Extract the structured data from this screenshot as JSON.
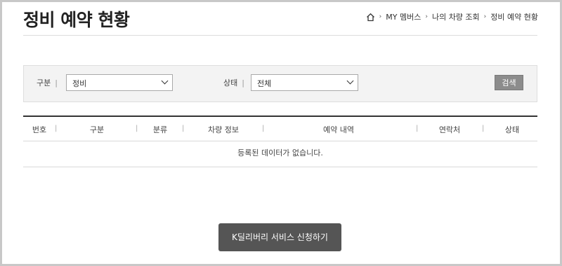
{
  "page": {
    "title": "정비 예약 현황"
  },
  "breadcrumb": {
    "home_icon": "home-icon",
    "items": [
      "MY 멤버스",
      "나의 차량 조회",
      "정비 예약 현황"
    ],
    "separator": "›"
  },
  "search": {
    "category_label": "구분",
    "category_value": "정비",
    "status_label": "상태",
    "status_value": "전체",
    "button_label": "검색"
  },
  "table": {
    "headers": [
      "번호",
      "구분",
      "분류",
      "차량 정보",
      "예약 내역",
      "연락처",
      "상태"
    ],
    "empty_message": "등록된 데이터가 없습니다."
  },
  "cta": {
    "label": "K딜리버리 서비스 신청하기"
  },
  "colors": {
    "cta_bg": "#555555",
    "search_button_bg": "#8c8c8c",
    "table_top_rule": "#333333"
  }
}
